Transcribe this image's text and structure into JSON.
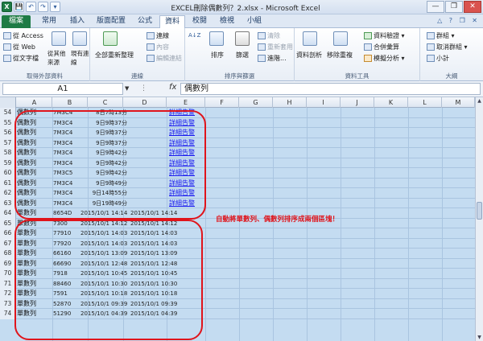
{
  "window": {
    "title": "EXCEL刪除偶數列？2.xlsx - Microsoft Excel",
    "quick_access": [
      "X",
      "💾",
      "↶",
      "↷",
      "▾"
    ],
    "controls": [
      "—",
      "❐",
      "✕"
    ]
  },
  "tabs": [
    "檔案",
    "常用",
    "插入",
    "版面配置",
    "公式",
    "資料",
    "校閱",
    "檢視",
    "小組"
  ],
  "active_tab": "資料",
  "tab_right": "△ ? ❐ ✕",
  "ribbon": {
    "get_external": {
      "label": "取得外部資料",
      "items": [
        "從 Access",
        "從 Web",
        "從文字檔",
        "從其他來源",
        "現有連線"
      ]
    },
    "connections": {
      "label": "連線",
      "refresh": "全部重新整理",
      "items": [
        "連線",
        "內容",
        "編輯連結"
      ]
    },
    "sort_filter": {
      "label": "排序與篩選",
      "sort_az": "A↓Z",
      "sort": "排序",
      "filter": "篩選",
      "items": [
        "清除",
        "重新套用",
        "進階..."
      ]
    },
    "data_tools": {
      "label": "資料工具",
      "items": [
        "資料剖析",
        "移除重複",
        "資料驗證 ▾",
        "合併彙算",
        "模擬分析 ▾"
      ]
    },
    "outline": {
      "label": "大綱",
      "items": [
        "群組 ▾",
        "取消群組 ▾",
        "小計"
      ]
    }
  },
  "formula_bar": {
    "name_box": "A1",
    "fx": "fx",
    "value": "偶數列"
  },
  "columns": [
    "A",
    "B",
    "C",
    "D",
    "E",
    "F",
    "G",
    "H",
    "I",
    "J",
    "K",
    "L",
    "M"
  ],
  "rows": [
    {
      "n": "54",
      "a": "偶數列",
      "b": "7M3C4",
      "c": "8日7時13分",
      "d": "",
      "e": "詳細告警"
    },
    {
      "n": "55",
      "a": "偶數列",
      "b": "7M3C4",
      "c": "9日9時37分",
      "d": "",
      "e": "詳細告警"
    },
    {
      "n": "56",
      "a": "偶數列",
      "b": "7M3C4",
      "c": "9日9時37分",
      "d": "",
      "e": "詳細告警"
    },
    {
      "n": "57",
      "a": "偶數列",
      "b": "7M3C4",
      "c": "9日9時37分",
      "d": "",
      "e": "詳細告警"
    },
    {
      "n": "58",
      "a": "偶數列",
      "b": "7M3C4",
      "c": "9日9時42分",
      "d": "",
      "e": "詳細告警"
    },
    {
      "n": "59",
      "a": "偶數列",
      "b": "7M3C4",
      "c": "9日9時42分",
      "d": "",
      "e": "詳細告警"
    },
    {
      "n": "60",
      "a": "偶數列",
      "b": "7M3C5",
      "c": "9日9時42分",
      "d": "",
      "e": "詳細告警"
    },
    {
      "n": "61",
      "a": "偶數列",
      "b": "7M3C4",
      "c": "9日9時49分",
      "d": "",
      "e": "詳細告警"
    },
    {
      "n": "62",
      "a": "偶數列",
      "b": "7M3C4",
      "c": "9日14時55分",
      "d": "",
      "e": "詳細告警"
    },
    {
      "n": "63",
      "a": "偶數列",
      "b": "7M3C4",
      "c": "9日19時49分",
      "d": "",
      "e": "詳細告警"
    },
    {
      "n": "64",
      "a": "單數列",
      "b": "8654D",
      "c": "2015/10/1 14:14",
      "d": "2015/10/1 14:14",
      "e": ""
    },
    {
      "n": "65",
      "a": "單數列",
      "b": "7300",
      "c": "2015/10/1 14:12",
      "d": "2015/10/1 14:12",
      "e": ""
    },
    {
      "n": "66",
      "a": "單數列",
      "b": "77910",
      "c": "2015/10/1 14:03",
      "d": "2015/10/1 14:03",
      "e": ""
    },
    {
      "n": "67",
      "a": "單數列",
      "b": "77920",
      "c": "2015/10/1 14:03",
      "d": "2015/10/1 14:03",
      "e": ""
    },
    {
      "n": "68",
      "a": "單數列",
      "b": "66160",
      "c": "2015/10/1 13:09",
      "d": "2015/10/1 13:09",
      "e": ""
    },
    {
      "n": "69",
      "a": "單數列",
      "b": "66690",
      "c": "2015/10/1 12:48",
      "d": "2015/10/1 12:48",
      "e": ""
    },
    {
      "n": "70",
      "a": "單數列",
      "b": "7918",
      "c": "2015/10/1 10:45",
      "d": "2015/10/1 10:45",
      "e": ""
    },
    {
      "n": "71",
      "a": "單數列",
      "b": "88460",
      "c": "2015/10/1 10:30",
      "d": "2015/10/1 10:30",
      "e": ""
    },
    {
      "n": "72",
      "a": "單數列",
      "b": "7591",
      "c": "2015/10/1 10:18",
      "d": "2015/10/1 10:18",
      "e": ""
    },
    {
      "n": "73",
      "a": "單數列",
      "b": "52870",
      "c": "2015/10/1 09:39",
      "d": "2015/10/1 09:39",
      "e": ""
    },
    {
      "n": "74",
      "a": "單數列",
      "b": "51290",
      "c": "2015/10/1 04:39",
      "d": "2015/10/1 04:39",
      "e": ""
    }
  ],
  "annotation": "自動將單數列、偶數列排序成兩個區塊！",
  "colors": {
    "annotation": "#e0141b",
    "cell_background": "#c4dcf1",
    "hyperlink": "#1a1aee",
    "file_tab": "#1e7b45"
  }
}
